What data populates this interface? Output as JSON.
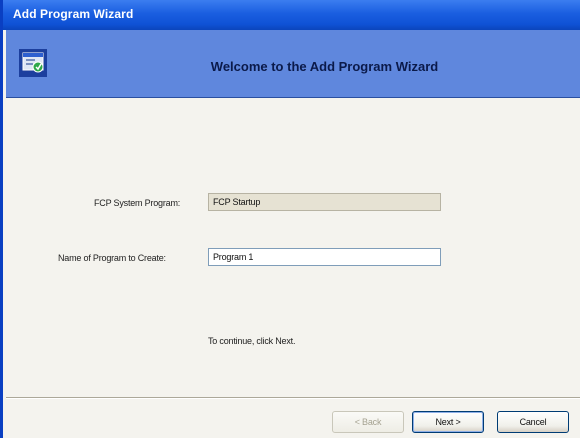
{
  "window": {
    "title": "Add Program Wizard"
  },
  "banner": {
    "title": "Welcome to the Add Program Wizard",
    "icon": "program-wizard-icon"
  },
  "form": {
    "system_program_label": "FCP System Program:",
    "system_program_value": "FCP Startup",
    "program_name_label": "Name of Program to Create:",
    "program_name_value": "Program 1"
  },
  "instruction": "To continue, click Next.",
  "buttons": {
    "back": "< Back",
    "next": "Next >",
    "cancel": "Cancel"
  },
  "colors": {
    "titlebar": "#0f52d6",
    "banner": "#5f87dd",
    "content_bg": "#f4f3ee"
  }
}
